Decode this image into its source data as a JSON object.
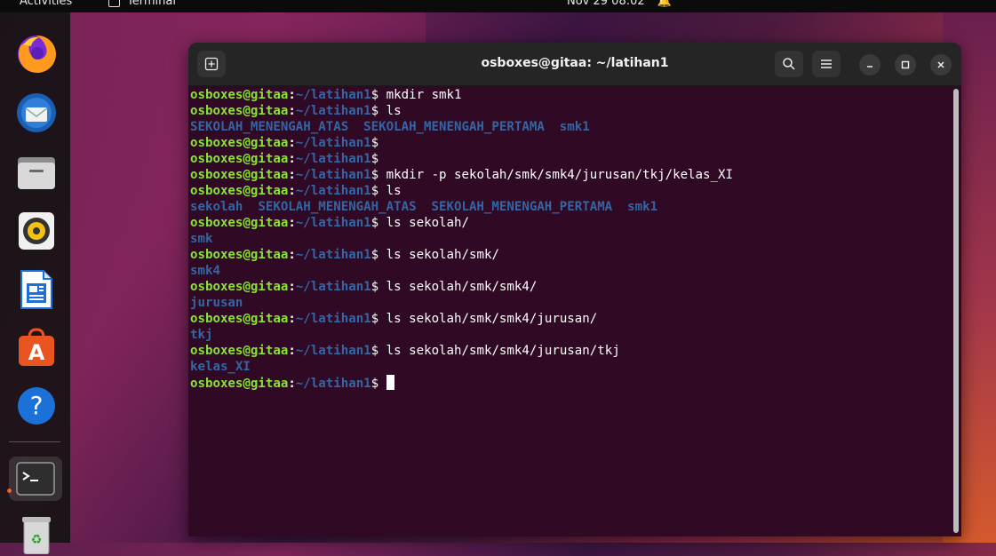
{
  "topbar": {
    "activities_label": "Activities",
    "app_label": "Terminal",
    "clock": "Nov 29  08:02",
    "bell_icon": "bell-icon"
  },
  "dock": {
    "items": [
      {
        "name": "Firefox",
        "icon": "firefox-icon"
      },
      {
        "name": "Thunderbird",
        "icon": "thunderbird-icon"
      },
      {
        "name": "Files",
        "icon": "files-icon"
      },
      {
        "name": "Rhythmbox",
        "icon": "rhythmbox-icon"
      },
      {
        "name": "LibreOffice Writer",
        "icon": "writer-icon"
      },
      {
        "name": "Ubuntu Software",
        "icon": "software-icon"
      },
      {
        "name": "Help",
        "icon": "help-icon"
      },
      {
        "name": "Terminal",
        "icon": "terminal-icon"
      },
      {
        "name": "Trash",
        "icon": "trash-icon"
      }
    ]
  },
  "terminal": {
    "title": "osboxes@gitaa: ~/latihan1",
    "prompt_user": "osboxes@gitaa",
    "prompt_colon": ":",
    "prompt_path": "~/latihan1",
    "prompt_dollar": "$ ",
    "lines": [
      {
        "type": "cmd",
        "text": "mkdir smk1"
      },
      {
        "type": "cmd",
        "text": "ls"
      },
      {
        "type": "out",
        "text": "SEKOLAH_MENENGAH_ATAS  SEKOLAH_MENENGAH_PERTAMA  smk1"
      },
      {
        "type": "cmd",
        "text": ""
      },
      {
        "type": "cmd",
        "text": ""
      },
      {
        "type": "cmd",
        "text": "mkdir -p sekolah/smk/smk4/jurusan/tkj/kelas_XI"
      },
      {
        "type": "cmd",
        "text": "ls"
      },
      {
        "type": "out",
        "text": "sekolah  SEKOLAH_MENENGAH_ATAS  SEKOLAH_MENENGAH_PERTAMA  smk1"
      },
      {
        "type": "cmd",
        "text": "ls sekolah/"
      },
      {
        "type": "out",
        "text": "smk"
      },
      {
        "type": "cmd",
        "text": "ls sekolah/smk/"
      },
      {
        "type": "out",
        "text": "smk4"
      },
      {
        "type": "cmd",
        "text": "ls sekolah/smk/smk4/"
      },
      {
        "type": "out",
        "text": "jurusan"
      },
      {
        "type": "cmd",
        "text": "ls sekolah/smk/smk4/jurusan/"
      },
      {
        "type": "out",
        "text": "tkj"
      },
      {
        "type": "cmd",
        "text": "ls sekolah/smk/smk4/jurusan/tkj"
      },
      {
        "type": "out",
        "text": "kelas_XI"
      },
      {
        "type": "cmd",
        "text": "",
        "cursor": true
      }
    ]
  },
  "colors": {
    "terminal_bg": "#300a24",
    "prompt_user": "#8ae234",
    "prompt_path": "#3465a4",
    "directory": "#3465a4",
    "accent": "#e95420"
  }
}
